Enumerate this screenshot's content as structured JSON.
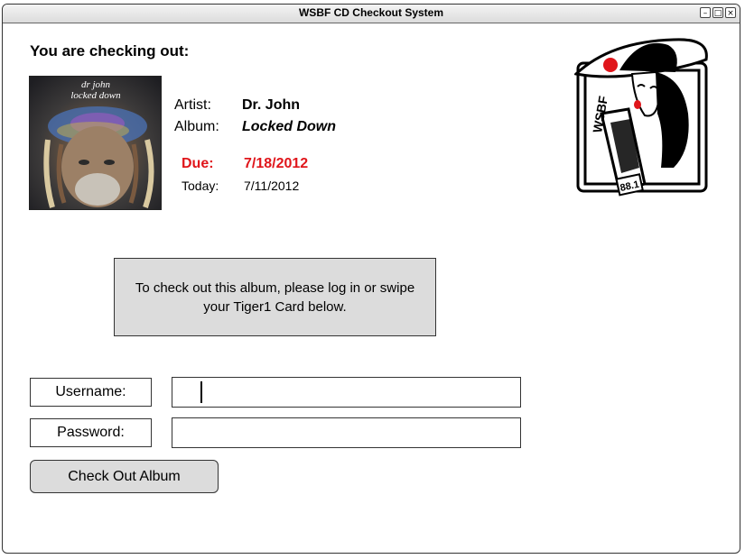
{
  "window": {
    "title": "WSBF CD Checkout System",
    "controls": [
      "minimize-icon",
      "maximize-icon",
      "close-icon"
    ]
  },
  "heading": "You are checking out:",
  "album_cover": {
    "line1": "dr john",
    "line2": "locked down"
  },
  "details": {
    "artist_label": "Artist:",
    "artist_value": "Dr. John",
    "album_label": "Album:",
    "album_value": "Locked Down",
    "due_label": "Due:",
    "due_value": "7/18/2012",
    "today_label": "Today:",
    "today_value": "7/11/2012"
  },
  "logo": {
    "text": "WSBF",
    "freq": "88.1"
  },
  "notice": "To check out this album, please log in or swipe your Tiger1 Card below.",
  "form": {
    "username_label": "Username:",
    "username_value": "",
    "password_label": "Password:",
    "password_value": "",
    "submit_label": "Check Out Album"
  },
  "colors": {
    "due": "#e0161b",
    "panel": "#dcdcdc"
  }
}
